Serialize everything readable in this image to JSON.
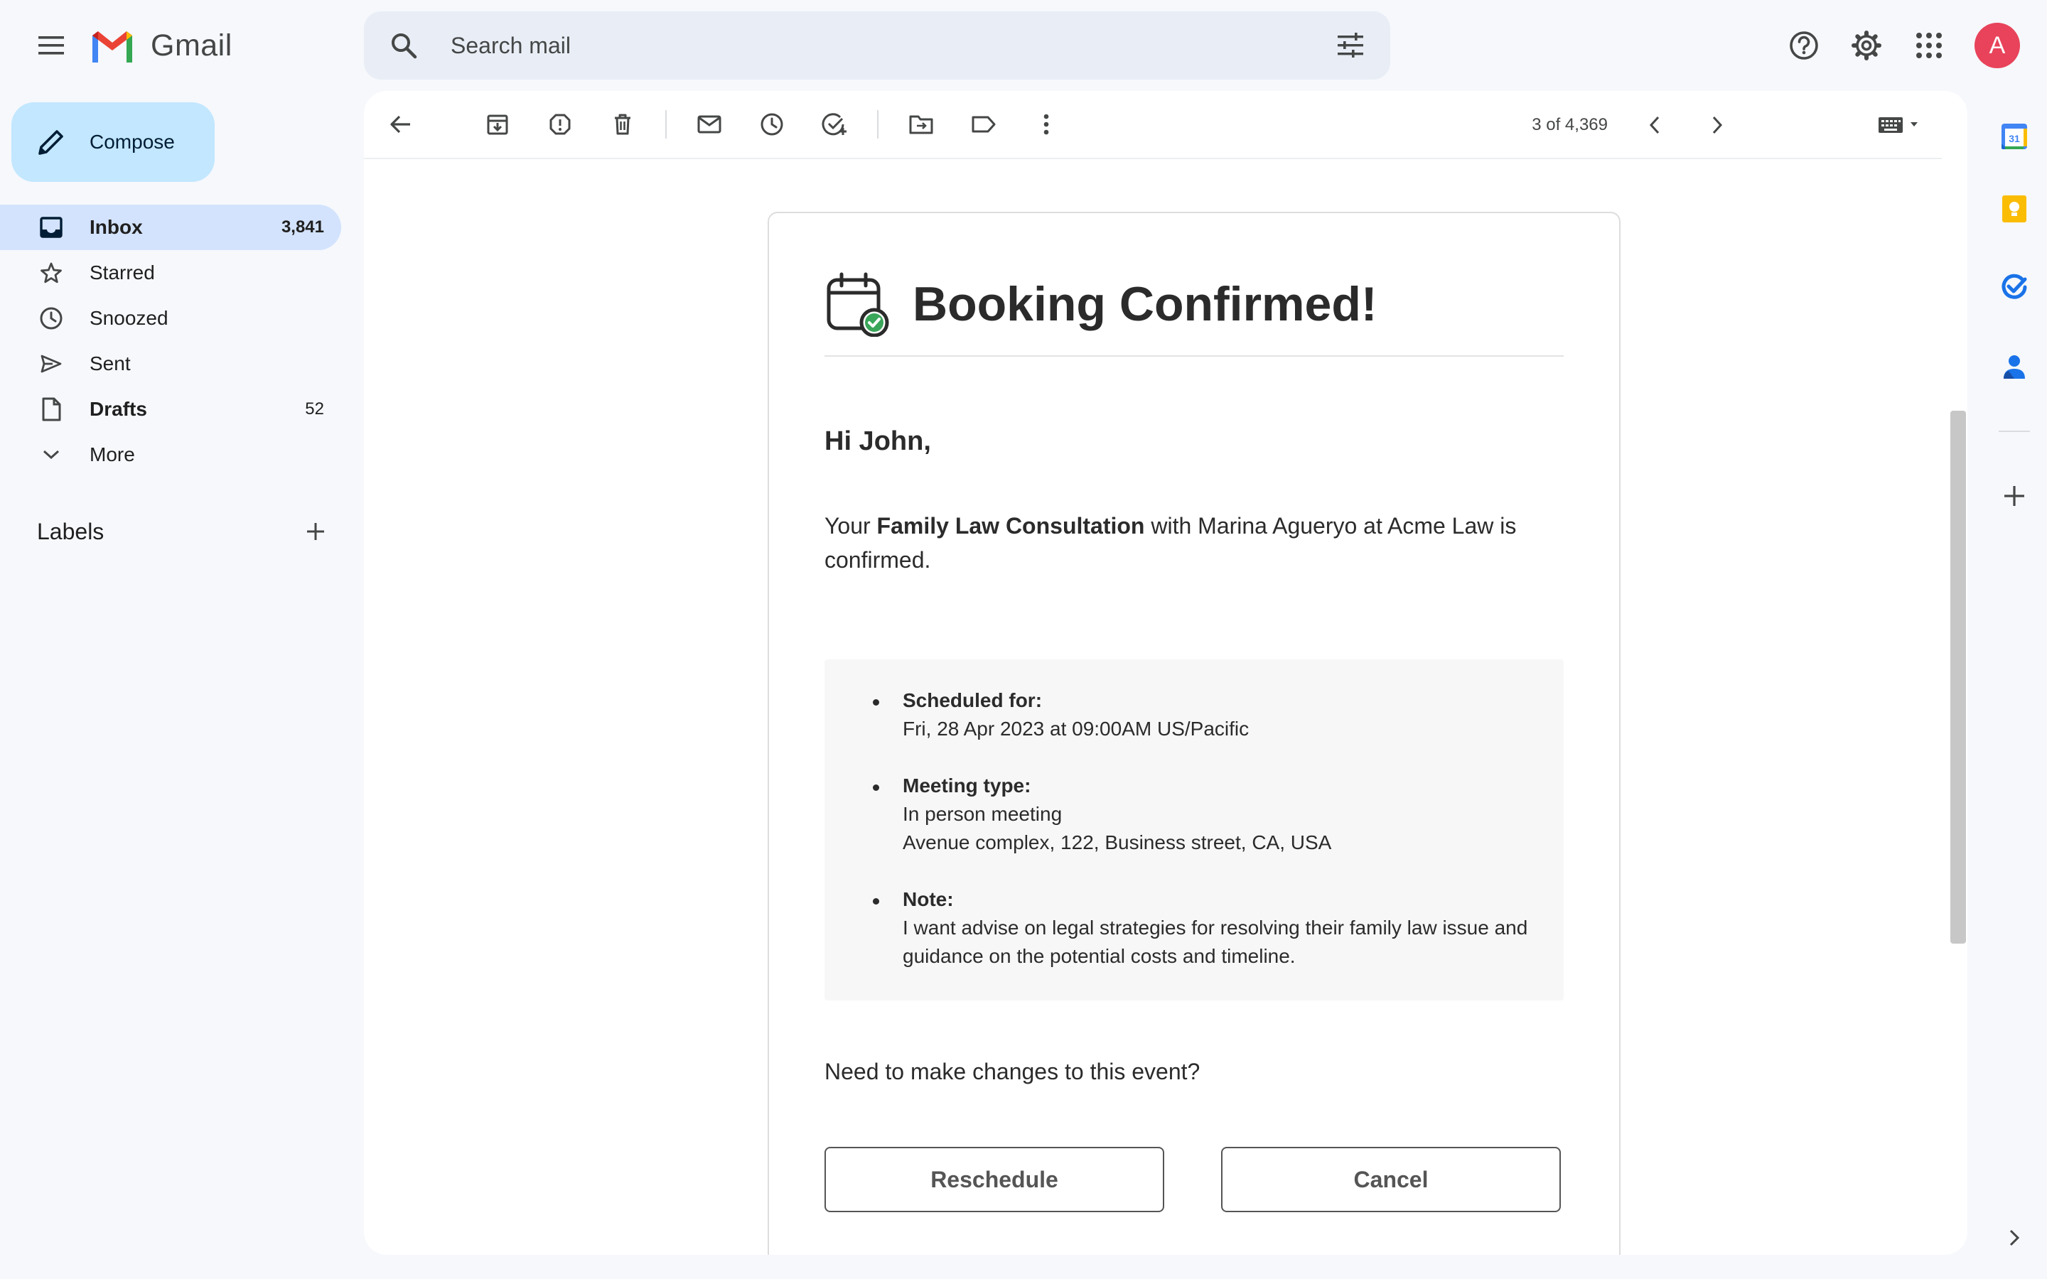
{
  "app": {
    "name": "Gmail"
  },
  "search": {
    "placeholder": "Search mail"
  },
  "user": {
    "initial": "A"
  },
  "compose": {
    "label": "Compose"
  },
  "nav": {
    "items": [
      {
        "label": "Inbox",
        "count": "3,841"
      },
      {
        "label": "Starred",
        "count": ""
      },
      {
        "label": "Snoozed",
        "count": ""
      },
      {
        "label": "Sent",
        "count": ""
      },
      {
        "label": "Drafts",
        "count": "52"
      },
      {
        "label": "More",
        "count": ""
      }
    ]
  },
  "labels": {
    "title": "Labels"
  },
  "pager": {
    "text": "3 of 4,369"
  },
  "email": {
    "title": "Booking Confirmed!",
    "greeting": "Hi John,",
    "intro_prefix": "Your ",
    "intro_bold": "Family Law Consultation",
    "intro_suffix": " with Marina Agueryo at Acme Law is confirmed.",
    "details": [
      {
        "title": "Scheduled for:",
        "lines": [
          "Fri, 28 Apr 2023 at 09:00AM US/Pacific"
        ]
      },
      {
        "title": "Meeting type:",
        "lines": [
          "In person meeting",
          "Avenue complex, 122, Business street, CA, USA"
        ]
      },
      {
        "title": "Note:",
        "lines": [
          "I want advise on legal strategies for resolving their family law issue and guidance on the potential costs and timeline."
        ]
      }
    ],
    "changes_prompt": "Need to make changes to this event?",
    "reschedule_label": "Reschedule",
    "cancel_label": "Cancel"
  },
  "side_panel": {
    "calendar_day": "31"
  },
  "colors": {
    "accent": "#0b57d0",
    "compose_bg": "#c2e7ff",
    "active_nav": "#d3e3fd",
    "avatar": "#e8435a",
    "app_bg": "#f6f8fc"
  }
}
